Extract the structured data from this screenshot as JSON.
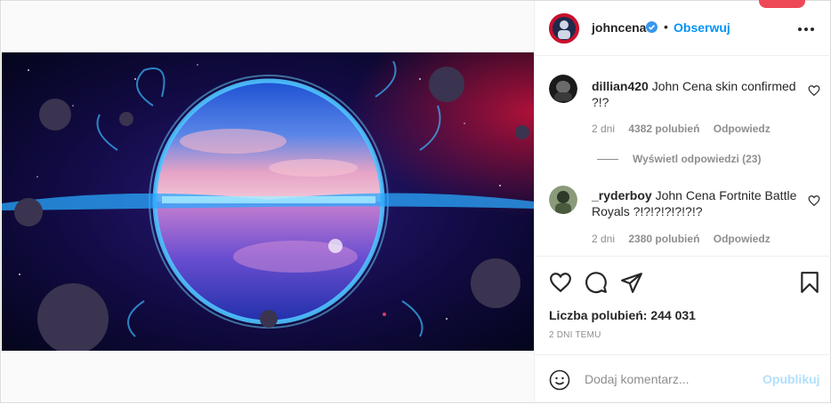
{
  "post": {
    "author": "johncena",
    "separator": "•",
    "follow_label": "Obserwuj",
    "comments": [
      {
        "username": "dillian420",
        "text": "John Cena skin confirmed ?!?",
        "age": "2 dni",
        "likes": "4382 polubień",
        "reply_label": "Odpowiedz",
        "view_replies": "Wyświetl odpowiedzi (23)"
      },
      {
        "username": "_ryderboy",
        "text": "John Cena Fortnite Battle Royals ?!?!?!?!?!?!?",
        "age": "2 dni",
        "likes": "2380 polubień",
        "reply_label": "Odpowiedz"
      }
    ],
    "likes_summary": "Liczba polubień: 244 031",
    "posted": "2 DNI TEMU"
  },
  "add_comment": {
    "placeholder": "Dodaj komentarz...",
    "publish_label": "Opublikuj"
  },
  "colors": {
    "link": "#0095f6",
    "publish_disabled": "#b2dffc",
    "muted": "#8e8e8e",
    "notification": "#ed4956"
  },
  "icons": [
    "verified-badge-icon",
    "more-options-icon",
    "heart-icon",
    "comment-icon",
    "share-icon",
    "bookmark-icon",
    "emoji-icon"
  ]
}
